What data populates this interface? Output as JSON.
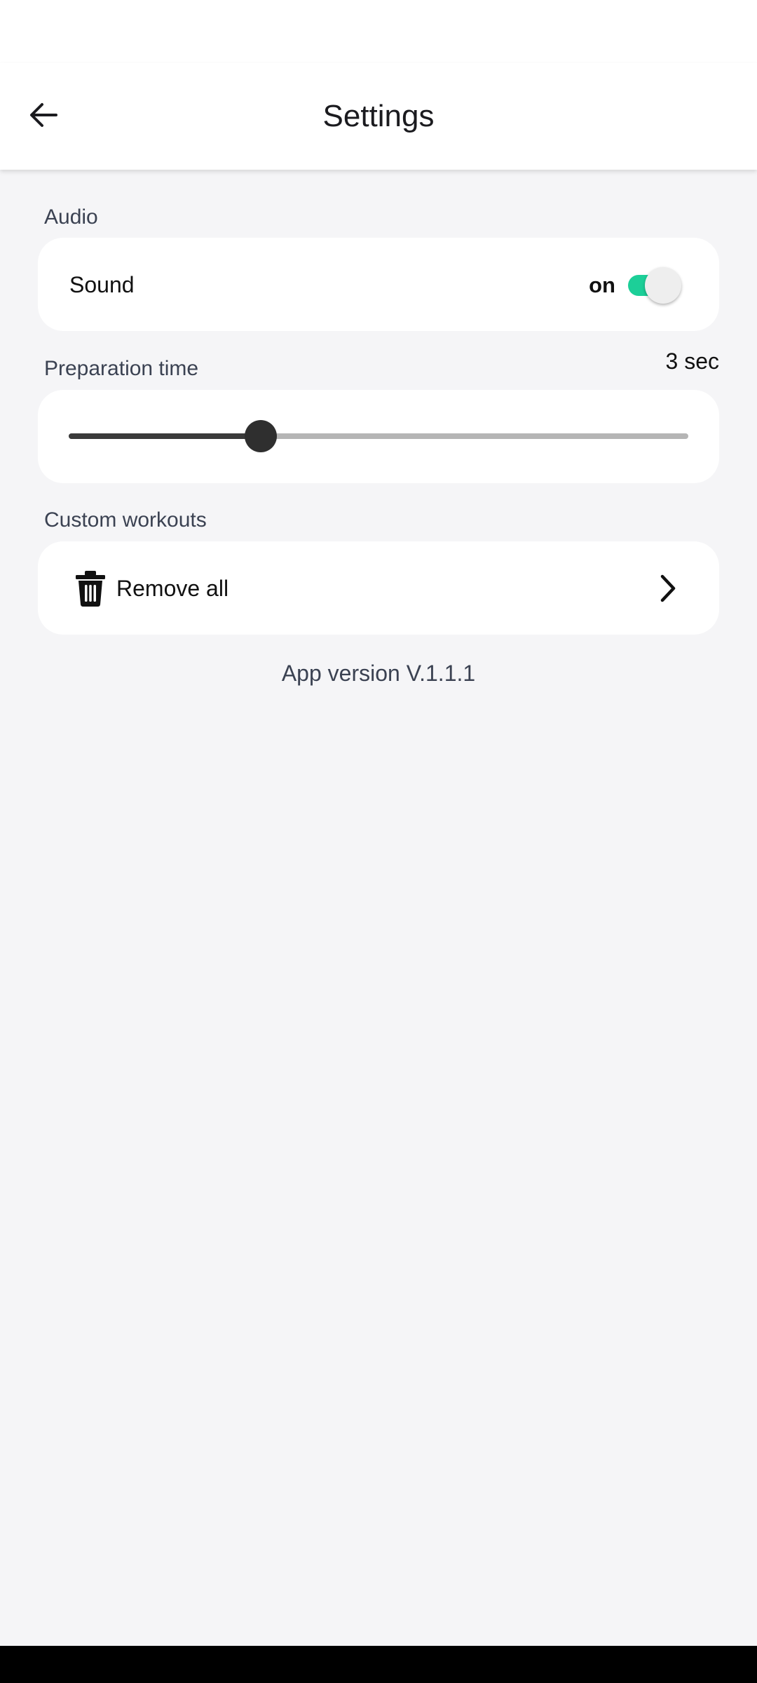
{
  "header": {
    "title": "Settings",
    "back_icon": "arrow-left-icon"
  },
  "audio": {
    "section_label": "Audio",
    "sound_label": "Sound",
    "sound_state": "on",
    "sound_enabled": true,
    "accent_color": "#1ccf98"
  },
  "preparation": {
    "section_label": "Preparation time",
    "value_label": "3 sec",
    "slider_fraction": 0.31
  },
  "custom_workouts": {
    "section_label": "Custom workouts",
    "remove_all_label": "Remove all",
    "icon": "trash-icon",
    "chevron_icon": "chevron-right-icon"
  },
  "footer": {
    "version": "App version V.1.1.1"
  }
}
